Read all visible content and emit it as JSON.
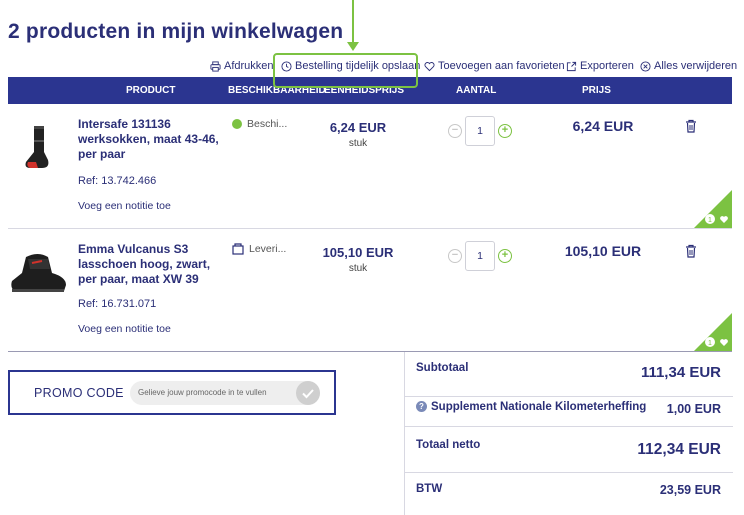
{
  "page": {
    "title": "2 producten in mijn winkelwagen"
  },
  "toolbar": {
    "print": "Afdrukken",
    "save_temp": "Bestelling tijdelijk opslaan",
    "add_favorites": "Toevoegen aan favorieten",
    "export": "Exporteren",
    "remove_all": "Alles verwijderen"
  },
  "table": {
    "headers": {
      "product": "PRODUCT",
      "availability": "BESCHIKBAARHEID",
      "unit_price": "EENHEIDSPRIJS",
      "quantity": "AANTAL",
      "price": "PRIJS"
    }
  },
  "items": [
    {
      "name": "Intersafe 131136 werksokken, maat 43-46, per paar",
      "ref": "Ref: 13.742.466",
      "note": "Voeg een notitie toe",
      "availability": "Beschi...",
      "unit_price": "6,24 EUR",
      "unit": "stuk",
      "quantity": "1",
      "total": "6,24 EUR",
      "fav_count": "1"
    },
    {
      "name": "Emma Vulcanus S3 lasschoen hoog, zwart, per paar, maat XW 39",
      "ref": "Ref: 16.731.071",
      "note": "Voeg een notitie toe",
      "availability": "Leveri...",
      "unit_price": "105,10 EUR",
      "unit": "stuk",
      "quantity": "1",
      "total": "105,10 EUR",
      "fav_count": "1"
    }
  ],
  "promo": {
    "label": "PROMO CODE",
    "placeholder": "Gelieve jouw promocode in te vullen"
  },
  "summary": {
    "subtotal_label": "Subtotaal",
    "subtotal_value": "111,34 EUR",
    "supplement_label": "Supplement Nationale Kilometerheffing",
    "supplement_value": "1,00 EUR",
    "net_label": "Totaal netto",
    "net_value": "112,34 EUR",
    "vat_label": "BTW",
    "vat_value": "23,59 EUR"
  },
  "colors": {
    "primary": "#2b3590",
    "text": "#2b2f77",
    "accent_green": "#7cc242"
  }
}
